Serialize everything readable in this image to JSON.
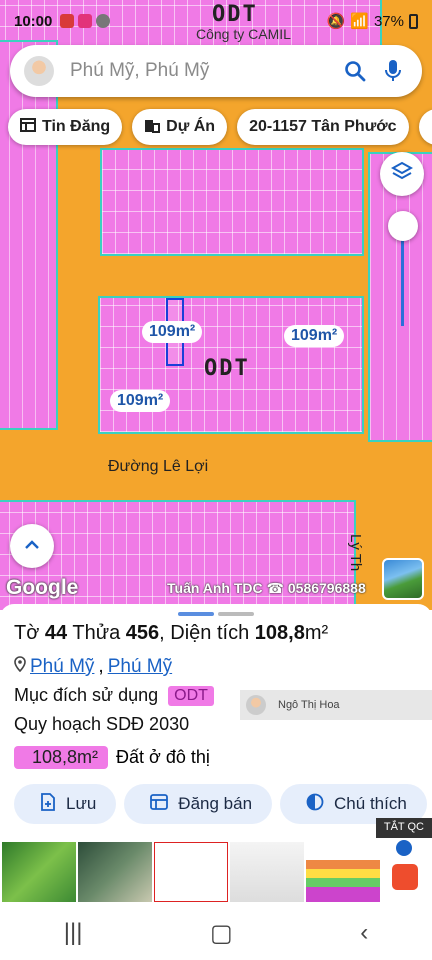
{
  "status_bar": {
    "time": "10:00",
    "battery": "37%"
  },
  "map": {
    "top_label": "ODT",
    "poi_label": "Công ty CAMIL",
    "block_label": "ODT",
    "area_labels": [
      "109m²",
      "109m²",
      "109m²"
    ],
    "road_label": "Đường Lê Lợi",
    "side_road_label": "Lý Th",
    "google_logo": "Google",
    "watermark": "Tuấn Anh TDC ☎ 0586796888"
  },
  "search": {
    "text": "Phú Mỹ, Phú Mỹ"
  },
  "chips": [
    {
      "label": "Tin Đăng",
      "icon": "newspaper-icon"
    },
    {
      "label": "Dự Án",
      "icon": "building-icon"
    },
    {
      "label": "20-1157 Tân Phước",
      "icon": ""
    },
    {
      "label": "",
      "icon": "tools-icon"
    }
  ],
  "sheet": {
    "to_label": "Tờ",
    "to_value": "44",
    "thua_label": "Thửa",
    "thua_value": "456",
    "area_label": ", Diện tích",
    "area_value": "108,8",
    "area_unit": "m²",
    "location_1": "Phú Mỹ",
    "location_2": "Phú Mỹ",
    "purpose_label": "Mục đích sử dụng",
    "purpose_code": "ODT",
    "plan_label": "Quy hoạch SDĐ 2030",
    "plan_area": "108,8m²",
    "plan_type": "Đất ở đô thị",
    "overlay_user": "Ngô Thị Hoa"
  },
  "actions": [
    {
      "label": "Lưu",
      "icon": "save-icon"
    },
    {
      "label": "Đăng bán",
      "icon": "listing-icon"
    },
    {
      "label": "Chú thích",
      "icon": "legend-icon"
    }
  ],
  "ad": {
    "close_label": "TẮT QC"
  },
  "colors": {
    "road": "#f4a52c",
    "residential": "#f07ae6",
    "boundary": "#3ad1c0",
    "accent": "#1a62c5"
  }
}
